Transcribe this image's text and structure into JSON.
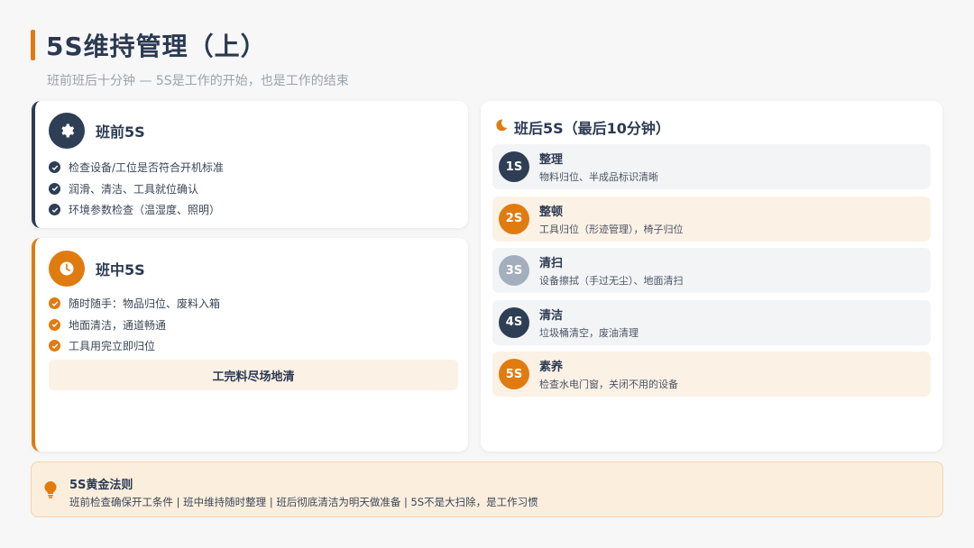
{
  "page": {
    "title": "5S维持管理（上）",
    "subtitle": "班前班后十分钟 — 5S是工作的开始，也是工作的结束"
  },
  "pre_shift": {
    "title": "班前5S",
    "icon": "gear-icon",
    "items": [
      "检查设备/工位是否符合开机标准",
      "润滑、清洁、工具就位确认",
      "环境参数检查（温湿度、照明）"
    ]
  },
  "mid_shift": {
    "title": "班中5S",
    "icon": "clock-icon",
    "items": [
      "随时随手：物品归位、废料入箱",
      "地面清洁，通道畅通",
      "工具用完立即归位"
    ],
    "note": "工完料尽场地清"
  },
  "post_shift": {
    "title": "班后5S（最后10分钟）",
    "icon": "moon-icon",
    "steps": [
      {
        "badge": "1S",
        "name": "整理",
        "desc": "物料归位、半成品标识清晰",
        "color": "#2d3e55"
      },
      {
        "badge": "2S",
        "name": "整顿",
        "desc": "工具归位（形迹管理），椅子归位",
        "color": "#e07b0f"
      },
      {
        "badge": "3S",
        "name": "清扫",
        "desc": "设备擦拭（手过无尘）、地面清扫",
        "color": "#a4afbd"
      },
      {
        "badge": "4S",
        "name": "清洁",
        "desc": "垃圾桶清空，废油清理",
        "color": "#2d3e55"
      },
      {
        "badge": "5S",
        "name": "素养",
        "desc": "检查水电门窗，关闭不用的设备",
        "color": "#e07b0f"
      }
    ]
  },
  "golden_rule": {
    "title": "5S黄金法则",
    "icon": "lightbulb-icon",
    "text": "班前检查确保开工条件 | 班中维持随时整理 | 班后彻底清洁为明天做准备 | 5S不是大扫除，是工作习惯"
  },
  "colors": {
    "navy": "#2d3e55",
    "orange": "#e07b0f",
    "gray": "#a4afbd"
  }
}
